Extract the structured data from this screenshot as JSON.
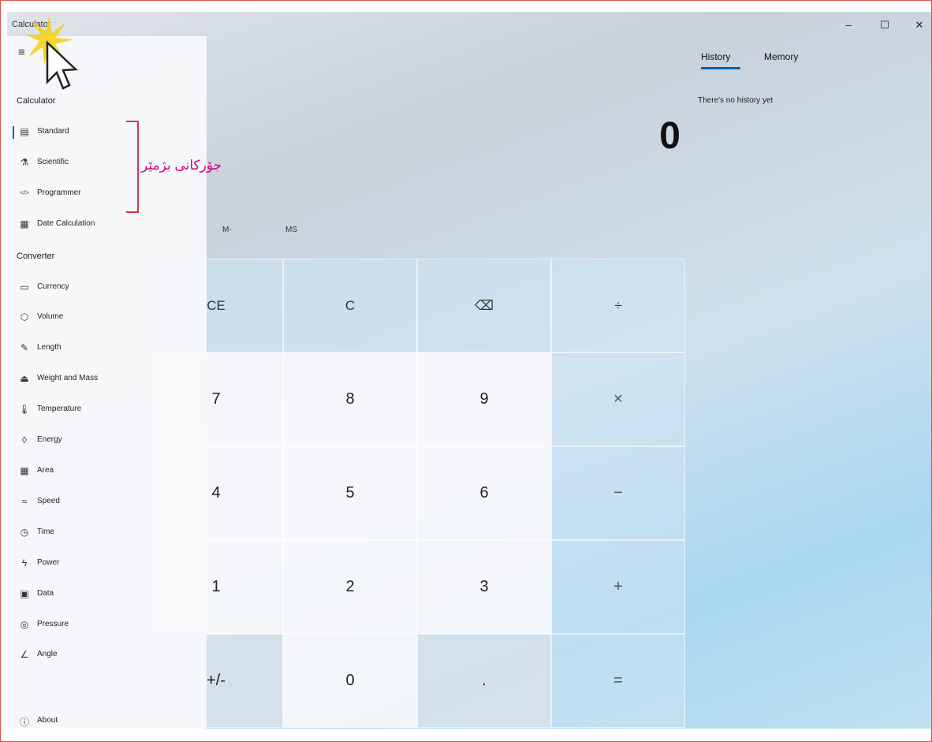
{
  "window": {
    "title": "Calculator",
    "minimize": "–",
    "maximize": "☐",
    "close": "✕"
  },
  "nav": {
    "menu_icon": "≡",
    "calculator_header": "Calculator",
    "calculator_items": [
      {
        "icon": "▤",
        "label": "Standard",
        "selected": true
      },
      {
        "icon": "⚗",
        "label": "Scientific"
      },
      {
        "icon": "</>",
        "label": "Programmer"
      },
      {
        "icon": "▦",
        "label": "Date Calculation"
      }
    ],
    "converter_header": "Converter",
    "converter_items": [
      {
        "icon": "▭",
        "label": "Currency"
      },
      {
        "icon": "⬡",
        "label": "Volume"
      },
      {
        "icon": "✎",
        "label": "Length"
      },
      {
        "icon": "⏏",
        "label": "Weight and Mass"
      },
      {
        "icon": "🌡",
        "label": "Temperature"
      },
      {
        "icon": "◊",
        "label": "Energy"
      },
      {
        "icon": "▦",
        "label": "Area"
      },
      {
        "icon": "≈",
        "label": "Speed"
      },
      {
        "icon": "◷",
        "label": "Time"
      },
      {
        "icon": "ϟ",
        "label": "Power"
      },
      {
        "icon": "▣",
        "label": "Data"
      },
      {
        "icon": "◎",
        "label": "Pressure"
      },
      {
        "icon": "∠",
        "label": "Angle"
      }
    ],
    "about": {
      "icon": "ⓘ",
      "label": "About"
    }
  },
  "annotation": {
    "text": "جۆرکانی بژمێر",
    "color": "#d10086"
  },
  "display": {
    "value": "0"
  },
  "memory": {
    "m_minus": "M-",
    "ms": "MS"
  },
  "keys": [
    [
      "CE",
      "C",
      "⌫",
      "÷"
    ],
    [
      "7",
      "8",
      "9",
      "×"
    ],
    [
      "4",
      "5",
      "6",
      "−"
    ],
    [
      "1",
      "2",
      "3",
      "+"
    ],
    [
      "+/-",
      "0",
      ".",
      "="
    ]
  ],
  "panel": {
    "history_tab": "History",
    "memory_tab": "Memory",
    "empty_message": "There's no history yet"
  },
  "colors": {
    "accent": "#0063b1",
    "bracket": "#d9364a"
  }
}
